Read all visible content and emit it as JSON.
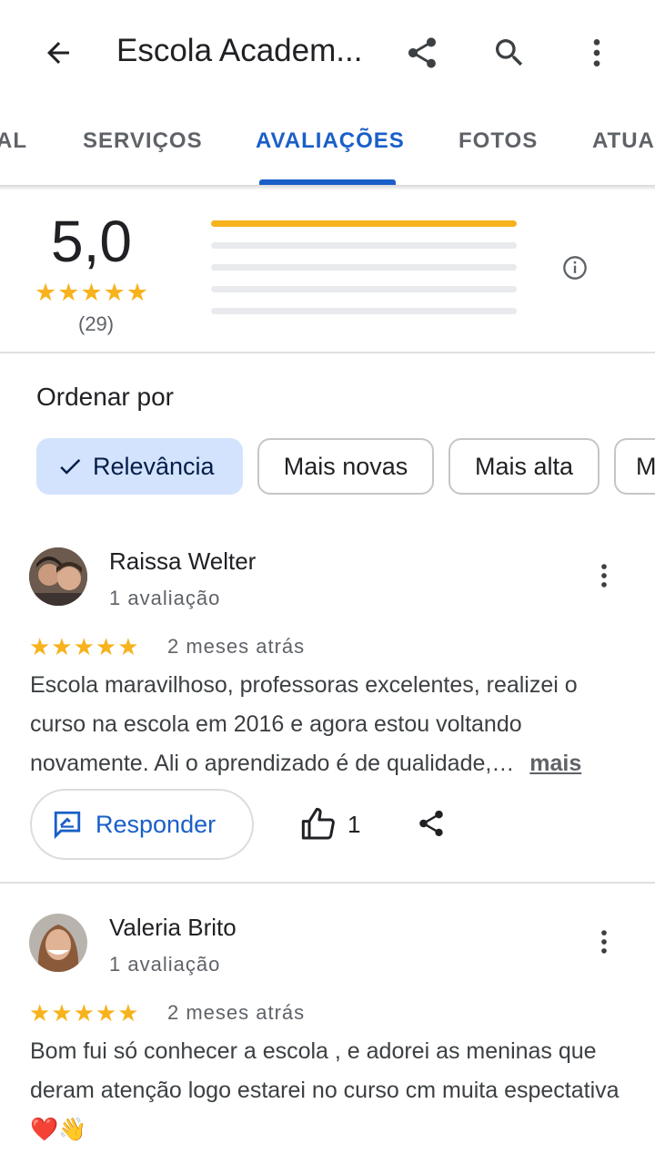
{
  "header": {
    "title": "Escola Academ..."
  },
  "tabs": [
    {
      "label": "AL"
    },
    {
      "label": "SERVIÇOS"
    },
    {
      "label": "AVALIAÇÕES"
    },
    {
      "label": "FOTOS"
    },
    {
      "label": "ATUAL"
    }
  ],
  "summary": {
    "rating": "5,0",
    "stars": "★★★★★",
    "count": "(29)",
    "distribution": [
      {
        "stars": 5,
        "fraction": 1.0
      },
      {
        "stars": 4,
        "fraction": 0
      },
      {
        "stars": 3,
        "fraction": 0
      },
      {
        "stars": 2,
        "fraction": 0
      },
      {
        "stars": 1,
        "fraction": 0
      }
    ]
  },
  "sort": {
    "title": "Ordenar por",
    "options": [
      "Relevância",
      "Mais novas",
      "Mais alta",
      "M"
    ],
    "selected": "Relevância"
  },
  "reviews": [
    {
      "name": "Raissa Welter",
      "sub": "1 avaliação",
      "stars": "★★★★★",
      "date": "2 meses atrás",
      "text": "Escola maravilhoso, professoras excelentes, realizei o curso na escola em 2016 e agora estou voltando novamente. Ali o aprendizado é de qualidade,…",
      "more": "mais",
      "respond_label": "Responder",
      "likes": "1"
    },
    {
      "name": "Valeria Brito",
      "sub": "1 avaliação",
      "stars": "★★★★★",
      "date": "2 meses atrás",
      "text": "Bom fui só conhecer a escola , e adorei as meninas que deram atenção logo estarei no curso cm muita espectativa ❤️👋"
    }
  ],
  "colors": {
    "accent": "#1a5fc8",
    "star": "#f7b21c",
    "chip_selected": "#d3e3fd"
  },
  "icons": [
    "back-arrow-icon",
    "share-icon",
    "search-icon",
    "more-vert-icon",
    "info-icon",
    "check-icon",
    "reply-icon",
    "thumb-up-icon"
  ]
}
